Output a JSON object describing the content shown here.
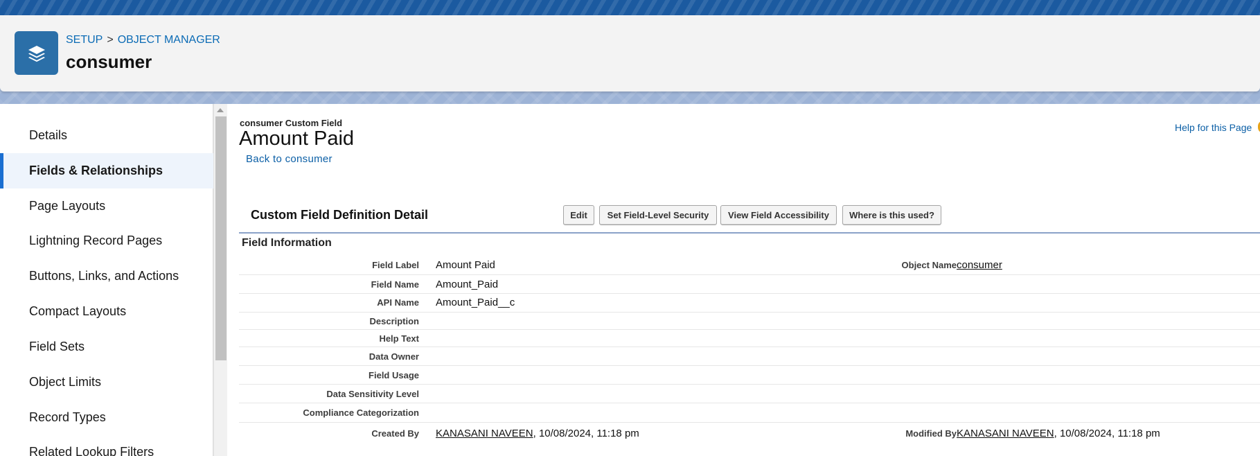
{
  "header": {
    "breadcrumb": {
      "setup": "SETUP",
      "separator": ">",
      "object_manager": "OBJECT MANAGER"
    },
    "object_title": "consumer",
    "app_icon": "stacked-layers-icon"
  },
  "sidebar": {
    "items": [
      {
        "label": "Details"
      },
      {
        "label": "Fields & Relationships",
        "active": true
      },
      {
        "label": "Page Layouts"
      },
      {
        "label": "Lightning Record Pages"
      },
      {
        "label": "Buttons, Links, and Actions"
      },
      {
        "label": "Compact Layouts"
      },
      {
        "label": "Field Sets"
      },
      {
        "label": "Object Limits"
      },
      {
        "label": "Record Types"
      },
      {
        "label": "Related Lookup Filters"
      }
    ]
  },
  "detail": {
    "record_type": "consumer Custom Field",
    "record_name": "Amount Paid",
    "back_link": "Back to consumer",
    "help_link": "Help for this Page",
    "section_title": "Custom Field Definition Detail",
    "buttons": {
      "edit": "Edit",
      "fls": "Set Field-Level Security",
      "accessibility": "View Field Accessibility",
      "where_used": "Where is this used?"
    },
    "subsection": "Field Information",
    "fields": {
      "field_label": {
        "label": "Field Label",
        "value": "Amount Paid"
      },
      "object_name": {
        "label": "Object Name",
        "value": "consumer"
      },
      "field_name": {
        "label": "Field Name",
        "value": "Amount_Paid"
      },
      "api_name": {
        "label": "API Name",
        "value": "Amount_Paid__c"
      },
      "description": {
        "label": "Description",
        "value": ""
      },
      "help_text": {
        "label": "Help Text",
        "value": ""
      },
      "data_owner": {
        "label": "Data Owner",
        "value": ""
      },
      "field_usage": {
        "label": "Field Usage",
        "value": ""
      },
      "data_sensitivity": {
        "label": "Data Sensitivity Level",
        "value": ""
      },
      "compliance": {
        "label": "Compliance Categorization",
        "value": ""
      },
      "created_by": {
        "label": "Created By",
        "user": "KANASANI NAVEEN",
        "date": ", 10/08/2024, 11:18 pm"
      },
      "modified_by": {
        "label": "Modified By",
        "user": "KANASANI NAVEEN",
        "date": ", 10/08/2024, 11:18 pm"
      }
    }
  },
  "colors": {
    "brand_blue": "#1b5aa0",
    "link_blue": "#0b6bb5",
    "active_bar": "#1b6fd1",
    "icon_bg": "#2b6fa8"
  }
}
